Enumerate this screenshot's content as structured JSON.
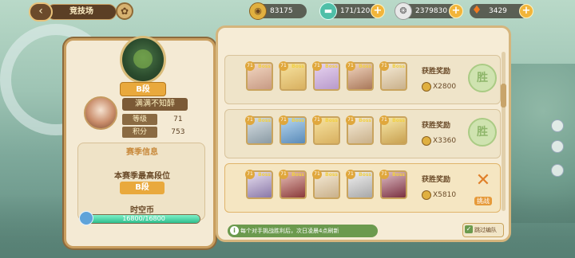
{
  "header": {
    "title": "竞技场",
    "back_icon": "back-arrow-icon",
    "resources": [
      {
        "icon": "gold-coin-icon",
        "value": "83175"
      },
      {
        "icon": "stamina-icon",
        "value": "171/120"
      },
      {
        "icon": "silver-coin-icon",
        "value": "2379830"
      },
      {
        "icon": "carrot-icon",
        "value": "3429"
      }
    ]
  },
  "player": {
    "rank_label": "B段",
    "name": "满满不知醉",
    "stats": [
      {
        "label": "等级",
        "value": "71"
      },
      {
        "label": "积分",
        "value": "753"
      }
    ]
  },
  "season": {
    "title": "赛季信息",
    "best_label": "本赛季最高段位",
    "best_rank": "B段",
    "coin_label": "时空币",
    "coin_text": "16800/16800",
    "coin_fraction": 1.0
  },
  "opponents": [
    {
      "reward_label": "获胜奖励",
      "reward_value": "X2800",
      "status": "胜"
    },
    {
      "reward_label": "获胜奖励",
      "reward_value": "X3360",
      "status": "胜"
    },
    {
      "reward_label": "获胜奖励",
      "reward_value": "X5810",
      "status": "挑战"
    }
  ],
  "unit_badge": "Boss",
  "footer": {
    "hint": "每个对手挑战胜利后，次日凌晨4点刷新",
    "skip_label": "跳过编队"
  },
  "colors": {
    "accent": "#e9a93d",
    "panel": "#f6ecd6",
    "hint_green": "#6b9a4e"
  }
}
